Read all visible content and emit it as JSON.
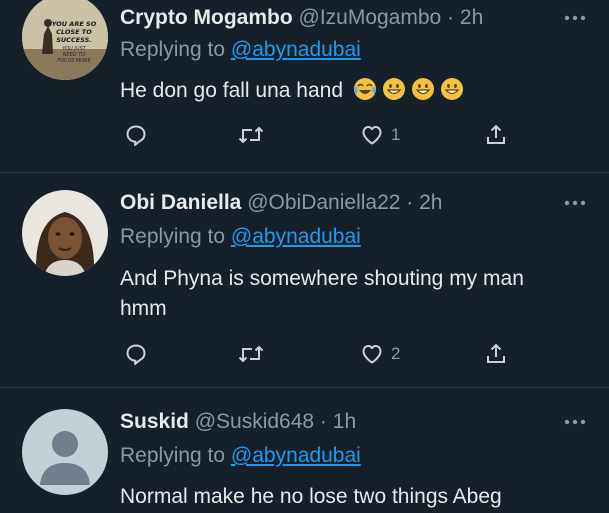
{
  "tweets": [
    {
      "name": "Crypto Mogambo",
      "handle": "@IzuMogambo",
      "sep": "·",
      "time": "2h",
      "reply_prefix": "Replying to",
      "reply_mention": "@abynadubai",
      "text": "He don go fall una hand",
      "avatar_text": [
        "YOU ARE SO",
        "CLOSE TO",
        "SUCCESS.",
        "YOU JUST",
        "NEED TO",
        "FOCUS MORE"
      ],
      "emojis": [
        "face-with-tears-of-joy-icon",
        "grinning-face-icon",
        "grinning-face-icon",
        "grinning-face-icon"
      ],
      "like_count": "1"
    },
    {
      "name": "Obi Daniella",
      "handle": "@ObiDaniella22",
      "sep": "·",
      "time": "2h",
      "reply_prefix": "Replying to",
      "reply_mention": "@abynadubai",
      "text": "And Phyna is somewhere shouting my man hmm",
      "like_count": "2"
    },
    {
      "name": "Suskid",
      "handle": "@Suskid648",
      "sep": "·",
      "time": "1h",
      "reply_prefix": "Replying to",
      "reply_mention": "@abynadubai",
      "text": "Normal make he no lose two things Abeg"
    }
  ],
  "colors": {
    "background": "#15202b",
    "text": "#e7e9ea",
    "muted": "#8b98a5",
    "link": "#1d9bf0",
    "divider": "#2f3b47"
  }
}
